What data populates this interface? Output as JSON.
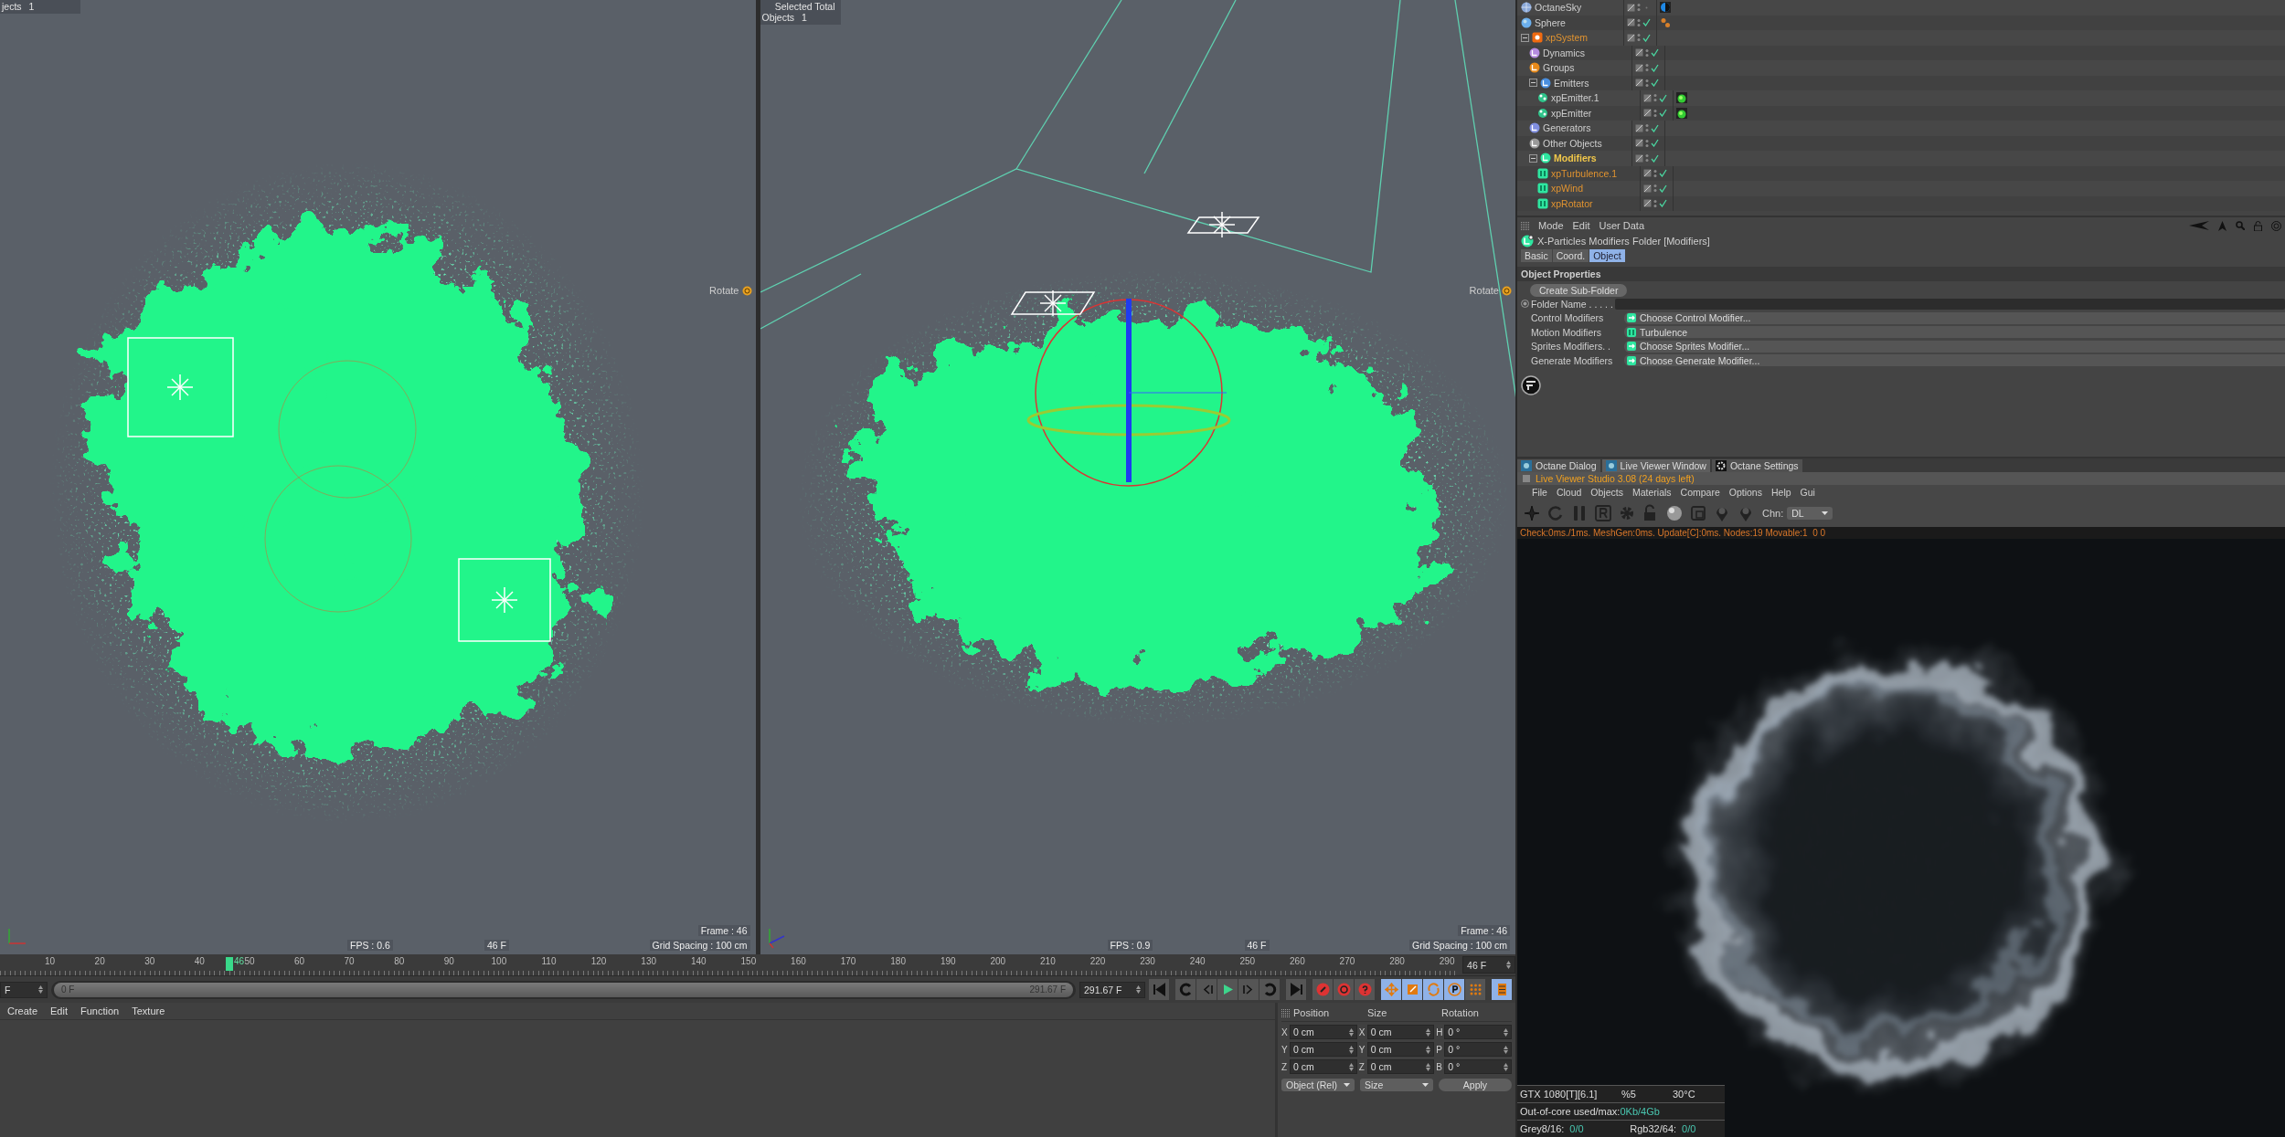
{
  "viewports": [
    {
      "kind": "front",
      "hud_rows": [
        {
          "label": "jects",
          "value": "1"
        }
      ],
      "rotate_label": "Rotate",
      "fps": "FPS : 0.6",
      "frame_field": "46 F",
      "frame": "Frame : 46",
      "grid_spacing": "Grid Spacing : 100 cm"
    },
    {
      "kind": "perspective",
      "hud_title": "Selected Total",
      "hud_rows": [
        {
          "label": "Objects",
          "value": "1"
        }
      ],
      "rotate_label": "Rotate",
      "fps": "FPS : 0.9",
      "frame_field": "46 F",
      "frame": "Frame : 46",
      "grid_spacing": "Grid Spacing : 100 cm"
    }
  ],
  "timeline": {
    "labels": [
      "10",
      "20",
      "30",
      "40",
      "50",
      "60",
      "70",
      "80",
      "90",
      "100",
      "110",
      "120",
      "130",
      "140",
      "150",
      "160",
      "170",
      "180",
      "190",
      "200",
      "210",
      "220",
      "230",
      "240",
      "250",
      "260",
      "270",
      "280",
      "290"
    ],
    "current": {
      "label": "46",
      "level": 0.1575
    },
    "frame_field": "46 F",
    "start_field": "F",
    "range": {
      "start": "0 F",
      "end": "291.67 F",
      "level": 1
    },
    "end_field": "291.67 F",
    "tool_toggles": [
      {
        "kind": "move",
        "on": true
      },
      {
        "kind": "scale",
        "on": true
      },
      {
        "kind": "rotate",
        "on": true
      },
      {
        "kind": "parameter",
        "on": true
      },
      {
        "kind": "points",
        "on": false
      }
    ],
    "film_toggle": {
      "on": true
    }
  },
  "material_manager": {
    "menu": [
      "Create",
      "Edit",
      "Function",
      "Texture"
    ]
  },
  "coordinates": {
    "headers": [
      "Position",
      "Size",
      "Rotation"
    ],
    "rows": [
      {
        "cells": [
          {
            "axis": "X",
            "value": "0 cm"
          },
          {
            "axis": "X",
            "value": "0 cm"
          },
          {
            "axis": "H",
            "value": "0 °"
          }
        ]
      },
      {
        "cells": [
          {
            "axis": "Y",
            "value": "0 cm"
          },
          {
            "axis": "Y",
            "value": "0 cm"
          },
          {
            "axis": "P",
            "value": "0 °"
          }
        ]
      },
      {
        "cells": [
          {
            "axis": "Z",
            "value": "0 cm"
          },
          {
            "axis": "Z",
            "value": "0 cm"
          },
          {
            "axis": "B",
            "value": "0 °"
          }
        ]
      }
    ],
    "mode": "Object (Rel)",
    "size_mode": "Size",
    "apply": "Apply"
  },
  "object_manager": {
    "items": [
      {
        "name": "OctaneSky",
        "kind": "sky",
        "enabled": false,
        "highlighted": false,
        "selected": false
      },
      {
        "name": "Sphere",
        "kind": "sphere",
        "enabled": true,
        "highlighted": false,
        "selected": false
      },
      {
        "name": "xpSystem",
        "kind": "system",
        "enabled": true,
        "highlighted": true,
        "selected": false,
        "expanded": true,
        "children": [
          {
            "name": "Dynamics",
            "kind": "folder",
            "color": "#b58be0",
            "enabled": true,
            "highlighted": false,
            "selected": false
          },
          {
            "name": "Groups",
            "kind": "folder",
            "color": "#e88a1a",
            "enabled": true,
            "highlighted": false,
            "selected": false
          },
          {
            "name": "Emitters",
            "kind": "folder",
            "color": "#4a8fe0",
            "enabled": true,
            "highlighted": false,
            "selected": false,
            "expanded": true,
            "children": [
              {
                "name": "xpEmitter.1",
                "kind": "emitter",
                "enabled": true,
                "highlighted": false,
                "selected": false
              },
              {
                "name": "xpEmitter",
                "kind": "emitter",
                "enabled": true,
                "highlighted": false,
                "selected": false
              }
            ]
          },
          {
            "name": "Generators",
            "kind": "folder",
            "color": "#7f8ee0",
            "enabled": true,
            "highlighted": false,
            "selected": false
          },
          {
            "name": "Other Objects",
            "kind": "folder",
            "color": "#9a9a9a",
            "enabled": true,
            "highlighted": false,
            "selected": false
          },
          {
            "name": "Modifiers",
            "kind": "folder",
            "color": "#2ee6a0",
            "enabled": true,
            "highlighted": false,
            "selected": true,
            "expanded": true,
            "children": [
              {
                "name": "xpTurbulence.1",
                "kind": "modifier",
                "enabled": true,
                "highlighted": true,
                "selected": false
              },
              {
                "name": "xpWind",
                "kind": "modifier",
                "enabled": true,
                "highlighted": true,
                "selected": false
              },
              {
                "name": "xpRotator",
                "kind": "modifier",
                "enabled": true,
                "highlighted": true,
                "selected": false
              }
            ]
          }
        ]
      }
    ]
  },
  "attribute_manager": {
    "menu": [
      "Mode",
      "Edit",
      "User Data"
    ],
    "title": "X-Particles Modifiers Folder [Modifiers]",
    "tabs": [
      {
        "label": "Basic",
        "selected": false
      },
      {
        "label": "Coord.",
        "selected": false
      },
      {
        "label": "Object",
        "selected": true
      }
    ],
    "section": "Object Properties",
    "create_button": "Create Sub-Folder",
    "folder_name_label": "Folder Name . . . . .",
    "fields": [
      {
        "label": "Control Modifiers",
        "value": "Choose Control Modifier...",
        "kind": "choose"
      },
      {
        "label": "Motion Modifiers",
        "value": "Turbulence",
        "kind": "turbulence"
      },
      {
        "label": "Sprites Modifiers. .",
        "value": "Choose Sprites Modifier...",
        "kind": "choose"
      },
      {
        "label": "Generate Modifiers",
        "value": "Choose Generate Modifier...",
        "kind": "choose"
      }
    ]
  },
  "octane": {
    "tabs": [
      {
        "label": "Octane Dialog",
        "kind": "octane",
        "selected": false
      },
      {
        "label": "Live Viewer Window",
        "kind": "octane",
        "selected": true
      },
      {
        "label": "Octane Settings",
        "kind": "gear",
        "selected": false
      }
    ],
    "title": "Live Viewer Studio 3.08 (24 days left)",
    "menu": [
      "File",
      "Cloud",
      "Objects",
      "Materials",
      "Compare",
      "Options",
      "Help",
      "Gui"
    ],
    "channel_label": "Chn:",
    "channel": "DL",
    "status": "Check:0ms./1ms. MeshGen:0ms. Update[C]:0ms. Nodes:19 Movable:1  0 0",
    "gpu": {
      "name": "GTX 1080[T][6.1]",
      "load": "%5",
      "temp": "30°C",
      "out_of_core_label": "Out-of-core used/max:",
      "out_of_core": "0Kb/4Gb",
      "grey_label": "Grey8/16:",
      "grey": "0/0",
      "rgb_label": "Rgb32/64:",
      "rgb": "0/0"
    }
  }
}
